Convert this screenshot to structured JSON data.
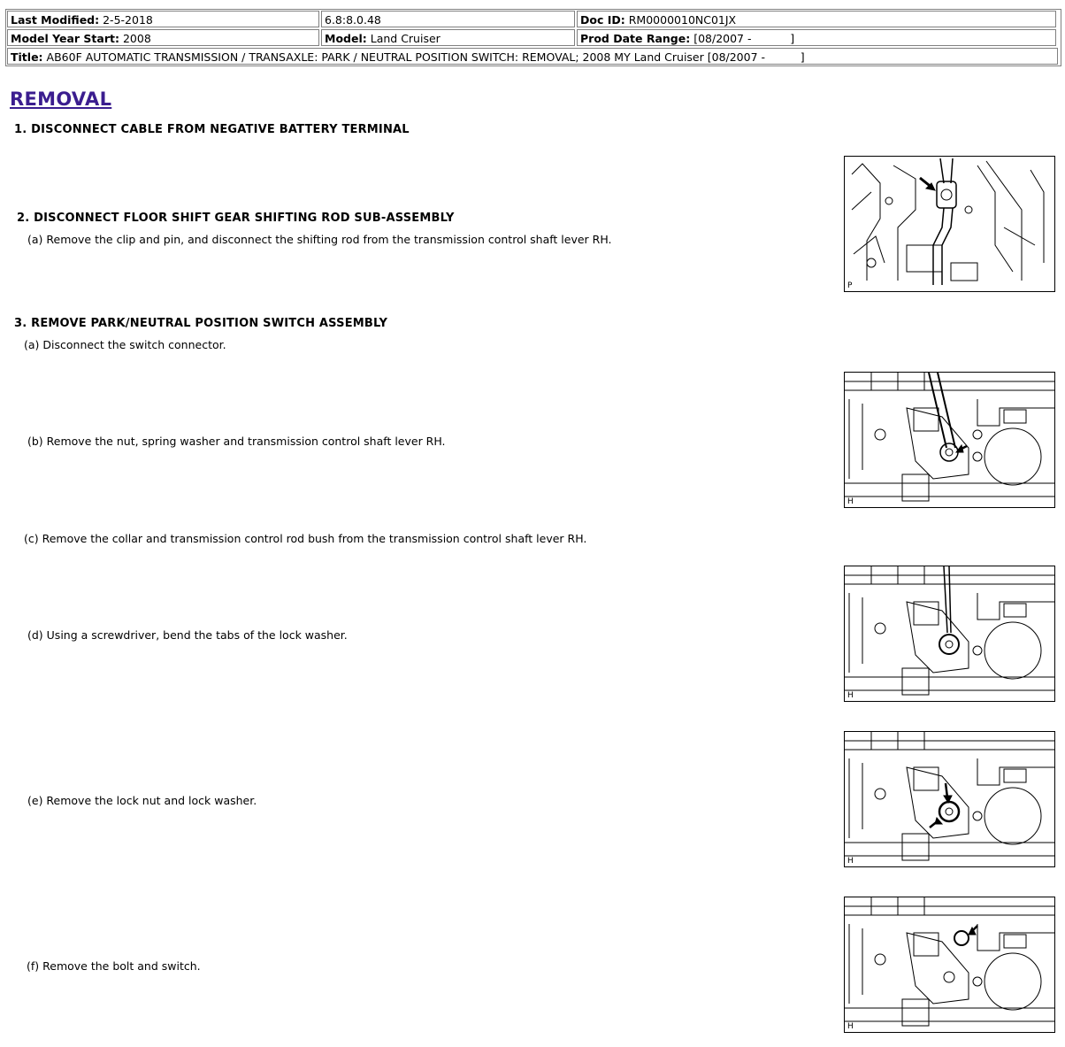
{
  "header": {
    "last_modified_label": "Last Modified:",
    "last_modified_value": "2-5-2018",
    "version": "6.8:8.0.48",
    "doc_id_label": "Doc ID:",
    "doc_id_value": "RM0000010NC01JX",
    "model_year_label": "Model Year Start:",
    "model_year_value": "2008",
    "model_label": "Model:",
    "model_value": "Land Cruiser",
    "prod_date_label": "Prod Date Range:",
    "prod_date_value": "[08/2007 -           ]",
    "title_label": "Title:",
    "title_value": "AB60F AUTOMATIC TRANSMISSION / TRANSAXLE: PARK / NEUTRAL POSITION SWITCH: REMOVAL; 2008 MY Land Cruiser [08/2007 -          ]"
  },
  "section_title": "REMOVAL",
  "steps": [
    "1. DISCONNECT CABLE FROM NEGATIVE BATTERY TERMINAL",
    "2. DISCONNECT FLOOR SHIFT GEAR SHIFTING ROD SUB-ASSEMBLY",
    "3. REMOVE PARK/NEUTRAL POSITION SWITCH ASSEMBLY"
  ],
  "substeps": {
    "s2a": "(a) Remove the clip and pin, and disconnect the shifting rod from the transmission control shaft lever RH.",
    "s3a": "(a) Disconnect the switch connector.",
    "s3b": "(b) Remove the nut, spring washer and transmission control shaft lever RH.",
    "s3c": "(c) Remove the collar and transmission control rod bush from the transmission control shaft lever RH.",
    "s3d": "(d) Using a screwdriver, bend the tabs of the lock washer.",
    "s3e": "(e) Remove the lock nut and lock washer.",
    "s3f": "(f) Remove the bolt and switch."
  },
  "figures": {
    "fig1_label": "P",
    "fig2_label": "H",
    "fig3_label": "H",
    "fig4_label": "H",
    "fig5_label": "H"
  }
}
